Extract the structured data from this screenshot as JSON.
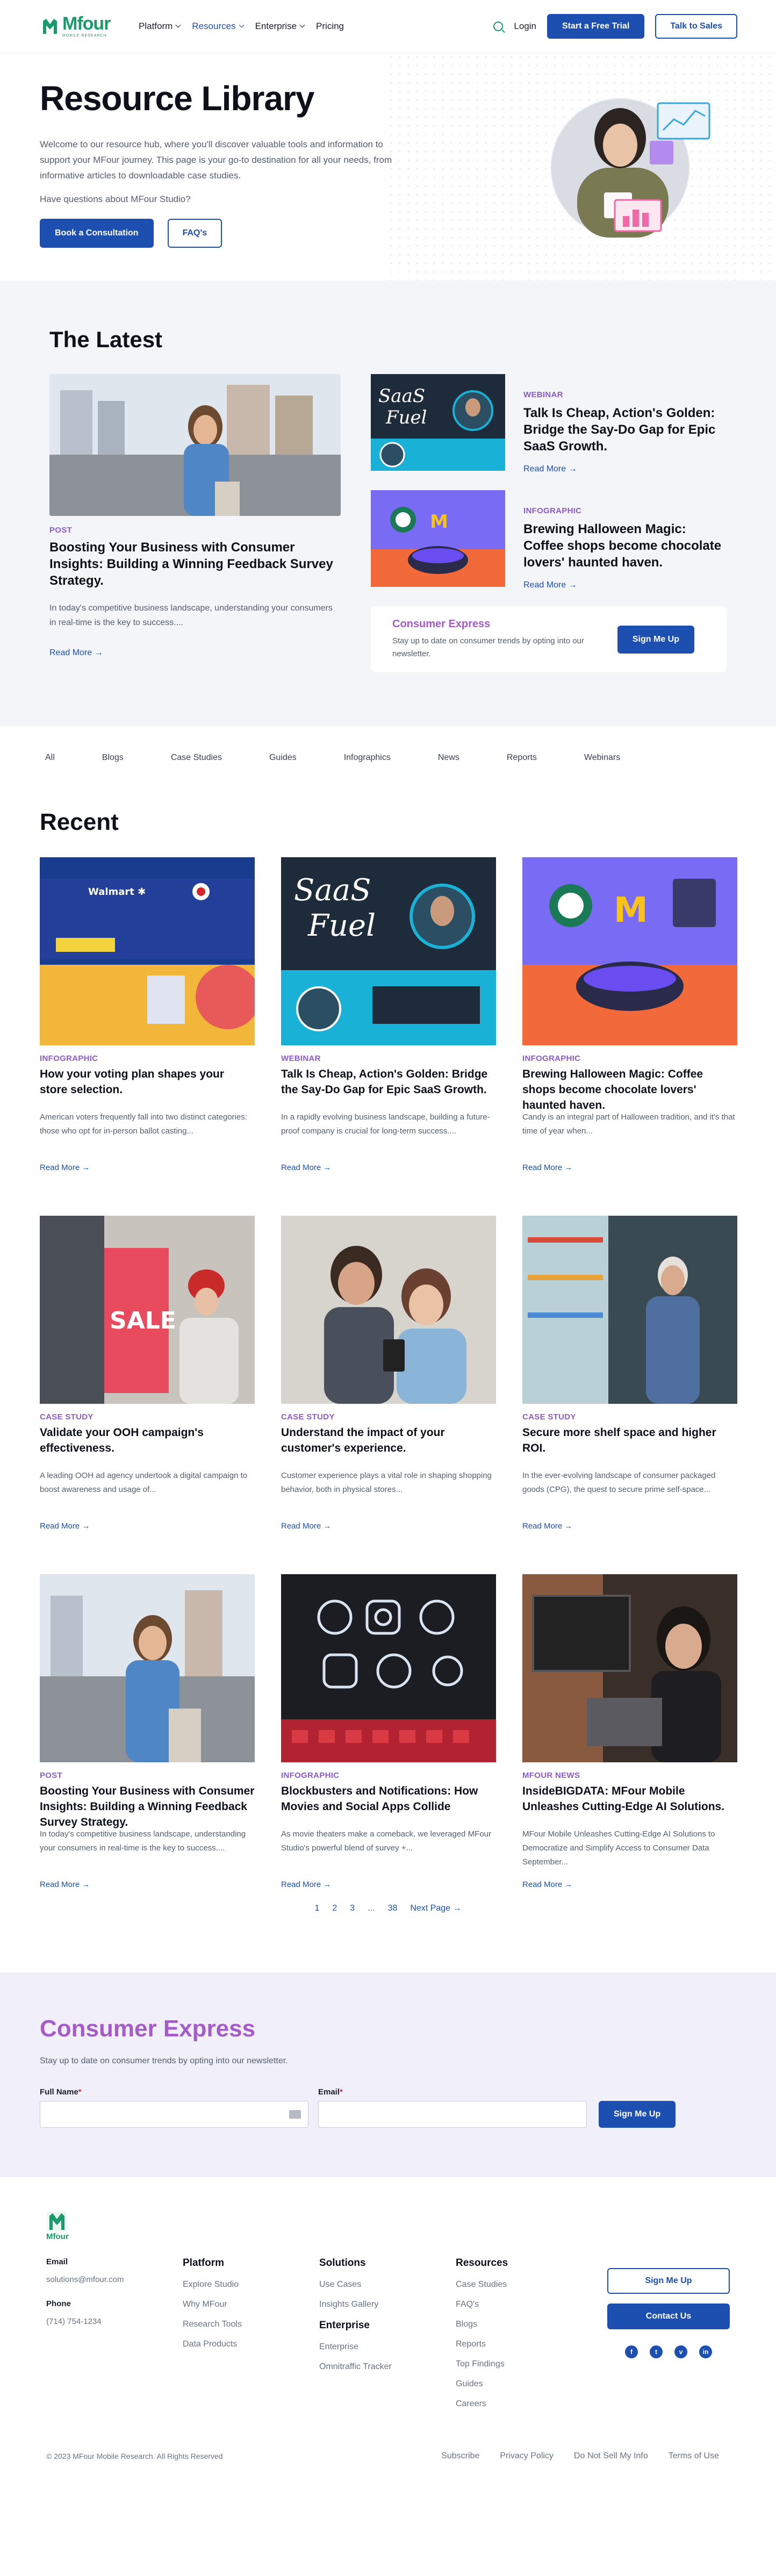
{
  "nav": {
    "logo": "Mfour",
    "logo_tagline": "MOBILE RESEARCH",
    "menu": [
      {
        "label": "Platform",
        "has_caret": true
      },
      {
        "label": "Resources",
        "has_caret": true
      },
      {
        "label": "Enterprise",
        "has_caret": true
      },
      {
        "label": "Pricing",
        "has_caret": false
      }
    ],
    "login": "Login",
    "trial_btn": "Start a Free Trial",
    "sales_btn": "Talk to Sales"
  },
  "hero": {
    "title": "Resource Library",
    "intro": "Welcome to our resource hub, where you'll discover valuable tools and information to support your MFour journey. This page is your go-to destination for all your needs, from informative articles to downloadable case studies.",
    "question": "Have questions about MFour Studio?",
    "consult_btn": "Book a Consultation",
    "faq_btn": "FAQ's"
  },
  "latest": {
    "title": "The Latest",
    "main": {
      "tag": "POST",
      "title": "Boosting Your Business with Consumer Insights: Building a Winning Feedback Survey Strategy.",
      "excerpt": "In today's competitive business landscape, understanding your consumers in real-time is the key to success....",
      "read_more": "Read More →"
    },
    "side": [
      {
        "tag": "WEBINAR",
        "title": "Talk Is Cheap, Action's Golden: Bridge the Say-Do Gap for Epic SaaS Growth.",
        "read_more": "Read More →"
      },
      {
        "tag": "INFOGRAPHIC",
        "title": "Brewing Halloween Magic: Coffee shops become chocolate lovers' haunted haven.",
        "read_more": "Read More →"
      }
    ],
    "promo": {
      "title": "Consumer Express",
      "text": "Stay up to date on consumer trends by opting into our newsletter.",
      "button": "Sign Me Up"
    }
  },
  "filters": [
    "All",
    "Blogs",
    "Case Studies",
    "Guides",
    "Infographics",
    "News",
    "Reports",
    "Webinars"
  ],
  "recent": {
    "title": "Recent",
    "cards": [
      {
        "tag": "INFOGRAPHIC",
        "title": "How your voting plan shapes your store selection.",
        "excerpt": "American voters frequently fall into two distinct categories: those who opt for in-person ballot casting...",
        "read_more": "Read More →"
      },
      {
        "tag": "WEBINAR",
        "title": "Talk Is Cheap, Action's Golden: Bridge the Say-Do Gap for Epic SaaS Growth.",
        "excerpt": "In a rapidly evolving business landscape, building a future-proof company is crucial for long-term success....",
        "read_more": "Read More →"
      },
      {
        "tag": "INFOGRAPHIC",
        "title": "Brewing Halloween Magic: Coffee shops become chocolate lovers' haunted haven.",
        "excerpt": "Candy is an integral part of Halloween tradition, and it's that time of year when...",
        "read_more": "Read More →"
      },
      {
        "tag": "CASE STUDY",
        "title": "Validate your OOH campaign's effectiveness.",
        "excerpt": "A leading OOH ad agency undertook a digital campaign to boost awareness and usage of...",
        "read_more": "Read More →"
      },
      {
        "tag": "CASE STUDY",
        "title": "Understand the impact of your customer's experience.",
        "excerpt": "Customer experience plays a vital role in shaping shopping behavior, both in physical stores...",
        "read_more": "Read More →"
      },
      {
        "tag": "CASE STUDY",
        "title": "Secure more shelf space and higher ROI.",
        "excerpt": "In the ever-evolving landscape of consumer packaged goods (CPG), the quest to secure prime self-space...",
        "read_more": "Read More →"
      },
      {
        "tag": "POST",
        "title": "Boosting Your Business with Consumer Insights: Building a Winning Feedback Survey Strategy.",
        "excerpt": "In today's competitive business landscape, understanding your consumers in real-time is the key to success....",
        "read_more": "Read More →"
      },
      {
        "tag": "INFOGRAPHIC",
        "title": "Blockbusters and Notifications: How Movies and Social Apps Collide",
        "excerpt": "As movie theaters make a comeback, we leveraged MFour Studio's powerful blend of survey +...",
        "read_more": "Read More →"
      },
      {
        "tag": "MFOUR NEWS",
        "title": "InsideBIGDATA: MFour Mobile Unleashes Cutting-Edge AI Solutions.",
        "excerpt": "MFour Mobile Unleashes Cutting-Edge AI Solutions to Democratize and Simplify Access to Consumer Data September...",
        "read_more": "Read More →"
      }
    ],
    "pager": {
      "p1": "1",
      "p2": "2",
      "p3": "3",
      "dots": "...",
      "last": "38",
      "next": "Next Page →"
    }
  },
  "express": {
    "title": "Consumer Express",
    "text": "Stay up to date on consumer trends by opting into our newsletter.",
    "name_label": "Full Name",
    "email_label": "Email",
    "required_mark": "*",
    "button": "Sign Me Up"
  },
  "footer": {
    "logo": "Mfour",
    "email_label": "Email",
    "email": "solutions@mfour.com",
    "phone_label": "Phone",
    "phone": "(714) 754-1234",
    "platform": {
      "title": "Platform",
      "links": [
        "Explore Studio",
        "Why MFour",
        "Research Tools",
        "Data Products"
      ]
    },
    "solutions": {
      "title": "Solutions",
      "links": [
        "Use Cases",
        "Insights Gallery"
      ]
    },
    "enterprise": {
      "title": "Enterprise",
      "links": [
        "Enterprise",
        "Omnitraffic Tracker"
      ]
    },
    "resources": {
      "title": "Resources",
      "links": [
        "Case Studies",
        "FAQ's",
        "Blogs",
        "Reports",
        "Top Findings",
        "Guides",
        "Careers"
      ]
    },
    "signup_btn": "Sign Me Up",
    "contact_btn": "Contact Us",
    "copyright": "© 2023 MFour Mobile Research. All Rights Reserved",
    "legal": [
      "Subscribe",
      "Privacy Policy",
      "Do Not Sell My Info",
      "Terms of Use"
    ]
  },
  "colors": {
    "brand_green": "#1a9a6a",
    "primary_blue": "#1d4fb0",
    "purple_tag": "#8e5cc8",
    "express_purple": "#a65cc8"
  }
}
